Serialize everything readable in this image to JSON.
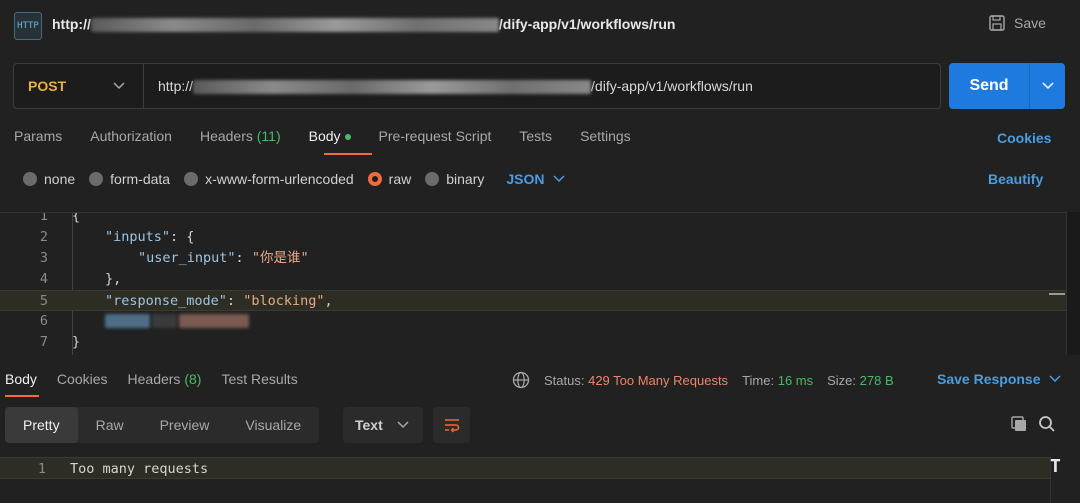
{
  "header": {
    "icon_label": "HTTP",
    "url_prefix": "http://",
    "url_suffix": "/dify-app/v1/workflows/run",
    "save_label": "Save"
  },
  "request": {
    "method": "POST",
    "url_prefix": "http://",
    "url_suffix": "/dify-app/v1/workflows/run",
    "send_label": "Send"
  },
  "req_tabs": {
    "params": "Params",
    "authorization": "Authorization",
    "headers": "Headers",
    "headers_count": "(11)",
    "body": "Body",
    "pre_request": "Pre-request Script",
    "tests": "Tests",
    "settings": "Settings",
    "cookies": "Cookies"
  },
  "body_options": {
    "none": "none",
    "form_data": "form-data",
    "urlencoded": "x-www-form-urlencoded",
    "raw": "raw",
    "binary": "binary",
    "format": "JSON",
    "beautify": "Beautify"
  },
  "editor": {
    "line_numbers": [
      "1",
      "2",
      "3",
      "4",
      "5",
      "6",
      "7"
    ],
    "line2_key": "\"inputs\"",
    "line2_rest": ": {",
    "line3_key": "\"user_input\"",
    "line3_colon": ": ",
    "line3_value": "\"你是谁\"",
    "line4": "},",
    "line5_key": "\"response_mode\"",
    "line5_colon": ": ",
    "line5_value": "\"blocking\"",
    "line5_comma": ","
  },
  "response_tabs": {
    "body": "Body",
    "cookies": "Cookies",
    "headers": "Headers",
    "headers_count": "(8)",
    "test_results": "Test Results"
  },
  "response_status": {
    "status_label": "Status:",
    "status_value": "429 Too Many Requests",
    "time_label": "Time:",
    "time_value": "16 ms",
    "size_label": "Size:",
    "size_value": "278 B",
    "save_response": "Save Response"
  },
  "response_view": {
    "pretty": "Pretty",
    "raw": "Raw",
    "preview": "Preview",
    "visualize": "Visualize",
    "format": "Text"
  },
  "response_body": {
    "line_number": "1",
    "text": "Too many requests"
  },
  "colors": {
    "accent_orange": "#f26b3a",
    "send_blue": "#1f7ae0",
    "link_blue": "#4a9de0",
    "method_yellow": "#e8b339",
    "status_red": "#f0836a",
    "ok_green": "#4cb86b"
  }
}
